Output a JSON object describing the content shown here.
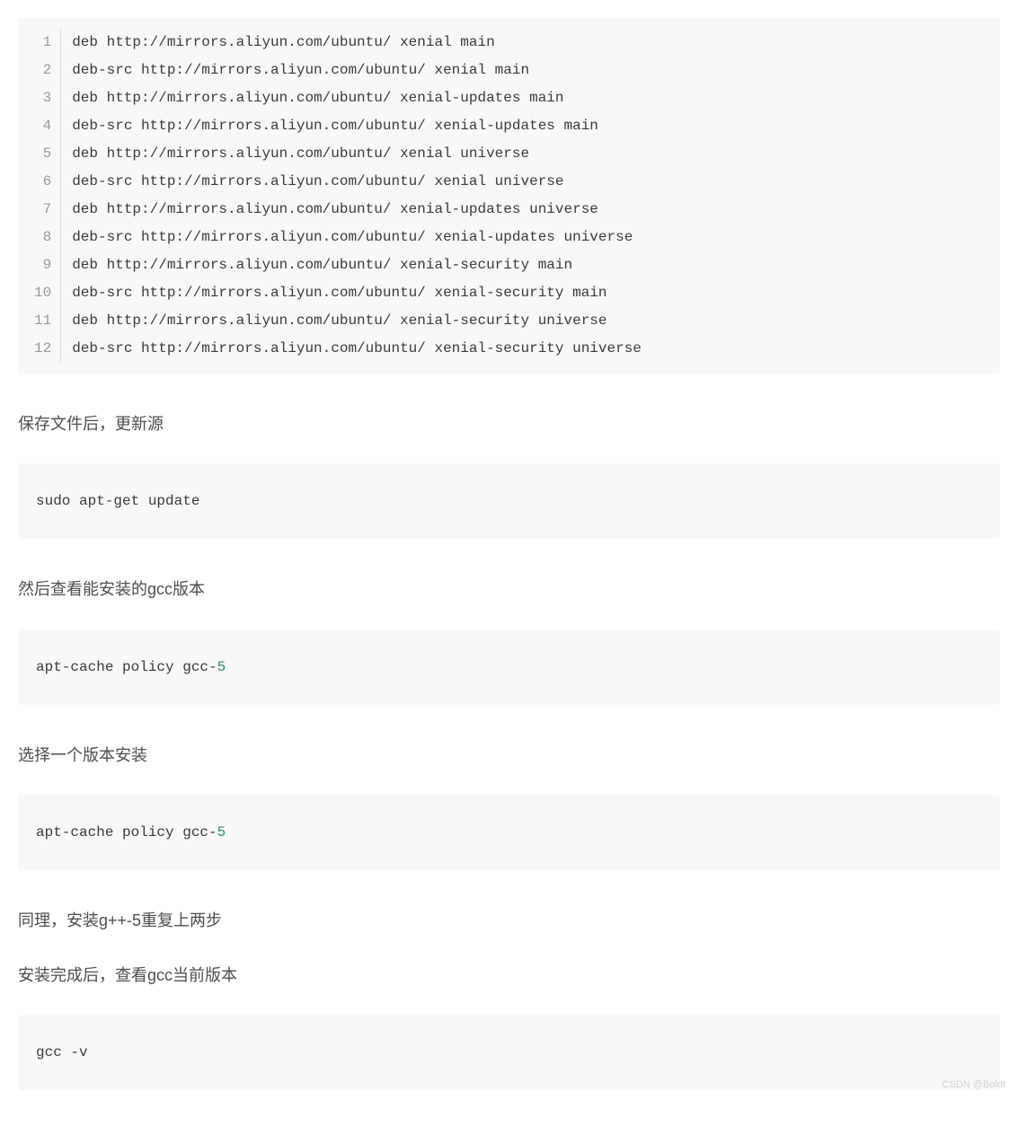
{
  "sources_list": {
    "lines": [
      "deb http://mirrors.aliyun.com/ubuntu/ xenial main",
      "deb-src http://mirrors.aliyun.com/ubuntu/ xenial main",
      "deb http://mirrors.aliyun.com/ubuntu/ xenial-updates main",
      "deb-src http://mirrors.aliyun.com/ubuntu/ xenial-updates main",
      "deb http://mirrors.aliyun.com/ubuntu/ xenial universe",
      "deb-src http://mirrors.aliyun.com/ubuntu/ xenial universe",
      "deb http://mirrors.aliyun.com/ubuntu/ xenial-updates universe",
      "deb-src http://mirrors.aliyun.com/ubuntu/ xenial-updates universe",
      "deb http://mirrors.aliyun.com/ubuntu/ xenial-security main",
      "deb-src http://mirrors.aliyun.com/ubuntu/ xenial-security main",
      "deb http://mirrors.aliyun.com/ubuntu/ xenial-security universe",
      "deb-src http://mirrors.aliyun.com/ubuntu/ xenial-security universe"
    ],
    "line_numbers": [
      "1",
      "2",
      "3",
      "4",
      "5",
      "6",
      "7",
      "8",
      "9",
      "10",
      "11",
      "12"
    ]
  },
  "prose": {
    "p1": "保存文件后，更新源",
    "p2": "然后查看能安装的gcc版本",
    "p3": "选择一个版本安装",
    "p4": "同理，安装g++-5重复上两步",
    "p5": "安装完成后，查看gcc当前版本"
  },
  "commands": {
    "c1": "sudo apt-get update",
    "c2_prefix": "apt-cache policy gcc-",
    "c2_num": "5",
    "c3_prefix": "apt-cache policy gcc-",
    "c3_num": "5",
    "c4": "gcc -v"
  },
  "watermark": "CSDN @Boldt"
}
